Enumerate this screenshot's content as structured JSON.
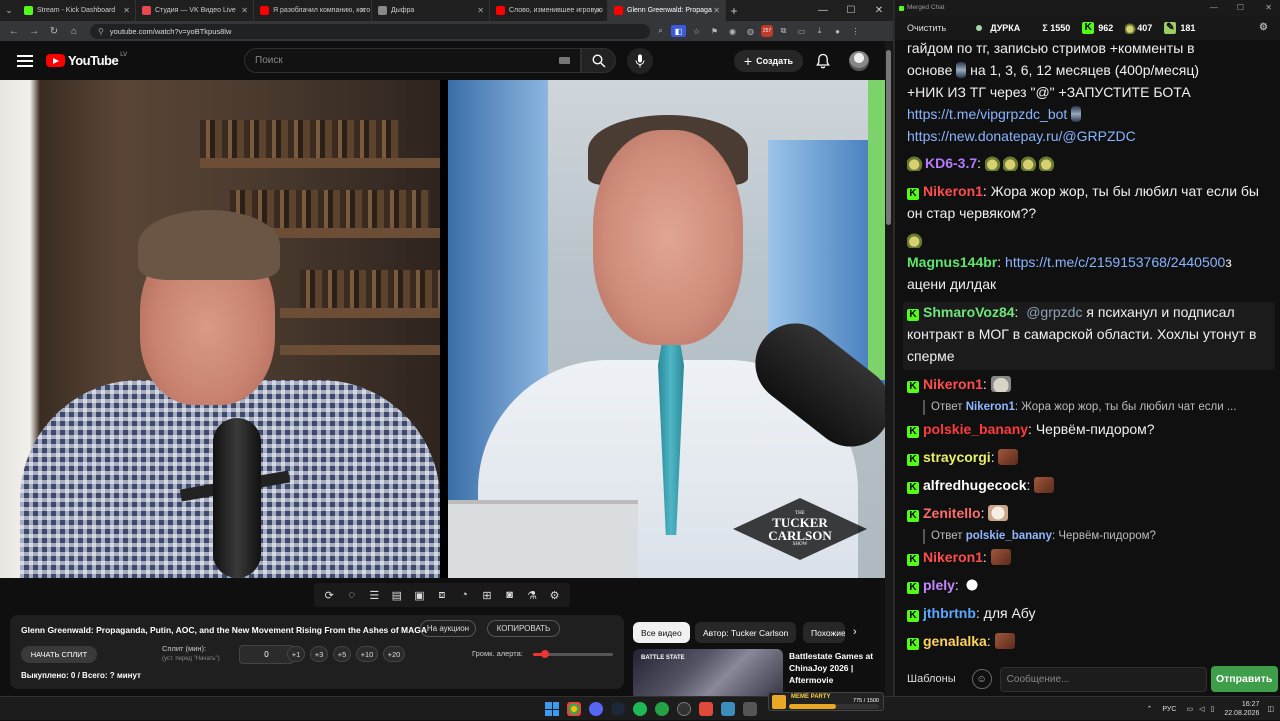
{
  "browser": {
    "tabs": [
      {
        "label": "Stream - Kick Dashboard",
        "color": "#53fc18"
      },
      {
        "label": "Студия — VK Видео Live",
        "color": "#e5484d"
      },
      {
        "label": "Я разоблачил компанию, кото",
        "color": "#ff0000"
      },
      {
        "label": "Дыфра",
        "color": "#888888"
      },
      {
        "label": "Слово, изменившее игровую",
        "color": "#ff0000"
      },
      {
        "label": "Glenn Greenwald: Propaga",
        "color": "#ff0000"
      }
    ],
    "url": "youtube.com/watch?v=yoBTkpus8lw",
    "badge": "257"
  },
  "youtube": {
    "logo": "YouTube",
    "region": "LV",
    "search_placeholder": "Поиск",
    "create_label": "Создать"
  },
  "video": {
    "watermark": [
      "THE",
      "TUCKER",
      "CARLSON",
      "SHOW"
    ]
  },
  "panel": {
    "title": "Glenn Greenwald: Propaganda, Putin, AOC, and the New Movement Rising From the Ashes of MAGA",
    "auction_label": "На аукцион",
    "copy_label": "КОПИРОВАТЬ",
    "split_button": "НАЧАТЬ СПЛИТ",
    "split_label": "Сплит (мин):",
    "split_hint": "(уст. перед \"Начать\")",
    "split_value": "0",
    "increments": [
      "+1",
      "+3",
      "+5",
      "+10",
      "+20"
    ],
    "volume_label": "Громк. алерта:",
    "volume_level": 0.15,
    "bought": "Выкуплено: 0 / Всего: ? минут"
  },
  "recs": {
    "chips": [
      "Все видео",
      "Автор: Tucker Carlson",
      "Похожие"
    ],
    "title": "Battlestate Games at ChinaJoy 2026 | Aftermovie",
    "thumb_label": "BATTLE STATE"
  },
  "chat": {
    "window_title": "Merged Chat",
    "clear_label": "Очистить",
    "stats": {
      "status": "ДУРКА",
      "total": "Σ 1550",
      "kick": "962",
      "twitch": "407",
      "other": "181"
    },
    "messages": {
      "m0": "гайдом по тг, записью стримов +комменты в",
      "m1a": "основе",
      "m1b": "на 1, 3, 6, 12 месяцев (400р/месяц)",
      "m2": "+НИК ИЗ ТГ через \"@\" +ЗАПУСТИТЕ БОТА",
      "m3": "https://t.me/vipgrpzdc_bot",
      "m4": "https://new.donatepay.ru/@GRPZDC",
      "kd6_user": "KD6-3.7",
      "nik1_user": "Nikeron1",
      "nik1_text": "Жора жор жор, ты бы любил чат если бы он стар червяком??",
      "mag_user": "Magnus144br",
      "mag_link": "https://t.me/c/2159153768/2440500",
      "mag_text1": "з",
      "mag_text2": "ацени дилдак",
      "shm_user": "ShmaroVoz84",
      "shm_mention": "@grpzdc",
      "shm_text": "я психанул и подписал контракт в МОГ в самарской области. Хохлы утонут в сперме",
      "nik2_user": "Nikeron1",
      "reply1_prefix": "Ответ",
      "reply1_user": "Nikeron1",
      "reply1_text": "Жора жор жор, ты бы любил чат если ...",
      "pb_user": "polskie_banany",
      "pb_text": "Червём-пидором?",
      "stray_user": "straycorgi",
      "alf_user": "alfredhugecock",
      "zen_user": "Zenitello",
      "reply2_prefix": "Ответ",
      "reply2_user": "polskie_banany",
      "reply2_text": "Червём-пидором?",
      "nik3_user": "Nikeron1",
      "pley_user": "plely",
      "jth_user": "jthbrtnb",
      "jth_text": "для Абу",
      "gen_user": "genalalka"
    },
    "user_colors": {
      "kd6": "#b57bff",
      "nikeron": "#ff4d4d",
      "magnus": "#5ee66e",
      "shmaro": "#6ee67a",
      "polskie": "#ff3b3b",
      "stray": "#e8f06a",
      "alfred": "#ffffff",
      "zenitello": "#ff6b6b",
      "plely": "#c487ff",
      "jth": "#5aa9ff",
      "genalalka": "#ffd35a"
    },
    "templates_label": "Шаблоны",
    "input_placeholder": "Сообщение...",
    "send_label": "Отправить"
  },
  "taskbar": {
    "widget_title": "MEME PARTY",
    "widget_count": "775 / 1500",
    "widget_progress": 0.517,
    "lang": "РУС",
    "time": "16:27",
    "date": "22.08.2026"
  }
}
